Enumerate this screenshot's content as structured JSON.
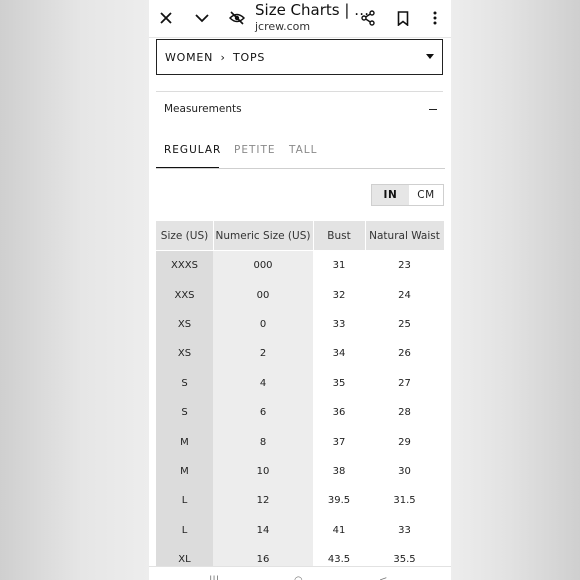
{
  "browser": {
    "title": "Size Charts | …",
    "domain": "jcrew.com",
    "icons": [
      "close-icon",
      "chevron-down-icon",
      "eye-off-icon",
      "share-icon",
      "bookmark-icon",
      "more-vert-icon"
    ]
  },
  "category_select": {
    "part1": "WOMEN",
    "separator": "›",
    "part2": "TOPS"
  },
  "section": {
    "title": "Measurements",
    "toggle_symbol": "−"
  },
  "tabs": [
    {
      "label": "REGULAR",
      "active": true
    },
    {
      "label": "PETITE",
      "active": false
    },
    {
      "label": "TALL",
      "active": false
    }
  ],
  "units": {
    "options": [
      "IN",
      "CM"
    ],
    "selected": "IN"
  },
  "table": {
    "headers": [
      "Size (US)",
      "Numeric Size (US)",
      "Bust",
      "Natural Waist"
    ],
    "rows": [
      [
        "XXXS",
        "000",
        "31",
        "23"
      ],
      [
        "XXS",
        "00",
        "32",
        "24"
      ],
      [
        "XS",
        "0",
        "33",
        "25"
      ],
      [
        "XS",
        "2",
        "34",
        "26"
      ],
      [
        "S",
        "4",
        "35",
        "27"
      ],
      [
        "S",
        "6",
        "36",
        "28"
      ],
      [
        "M",
        "8",
        "37",
        "29"
      ],
      [
        "M",
        "10",
        "38",
        "30"
      ],
      [
        "L",
        "12",
        "39.5",
        "31.5"
      ],
      [
        "L",
        "14",
        "41",
        "33"
      ],
      [
        "XL",
        "16",
        "43.5",
        "35.5"
      ]
    ]
  },
  "colors": {
    "size_column_bg": "#dcdcdc",
    "numeric_column_bg": "#ededed",
    "header_bg": "#e3e3e3",
    "text": "#222222"
  }
}
